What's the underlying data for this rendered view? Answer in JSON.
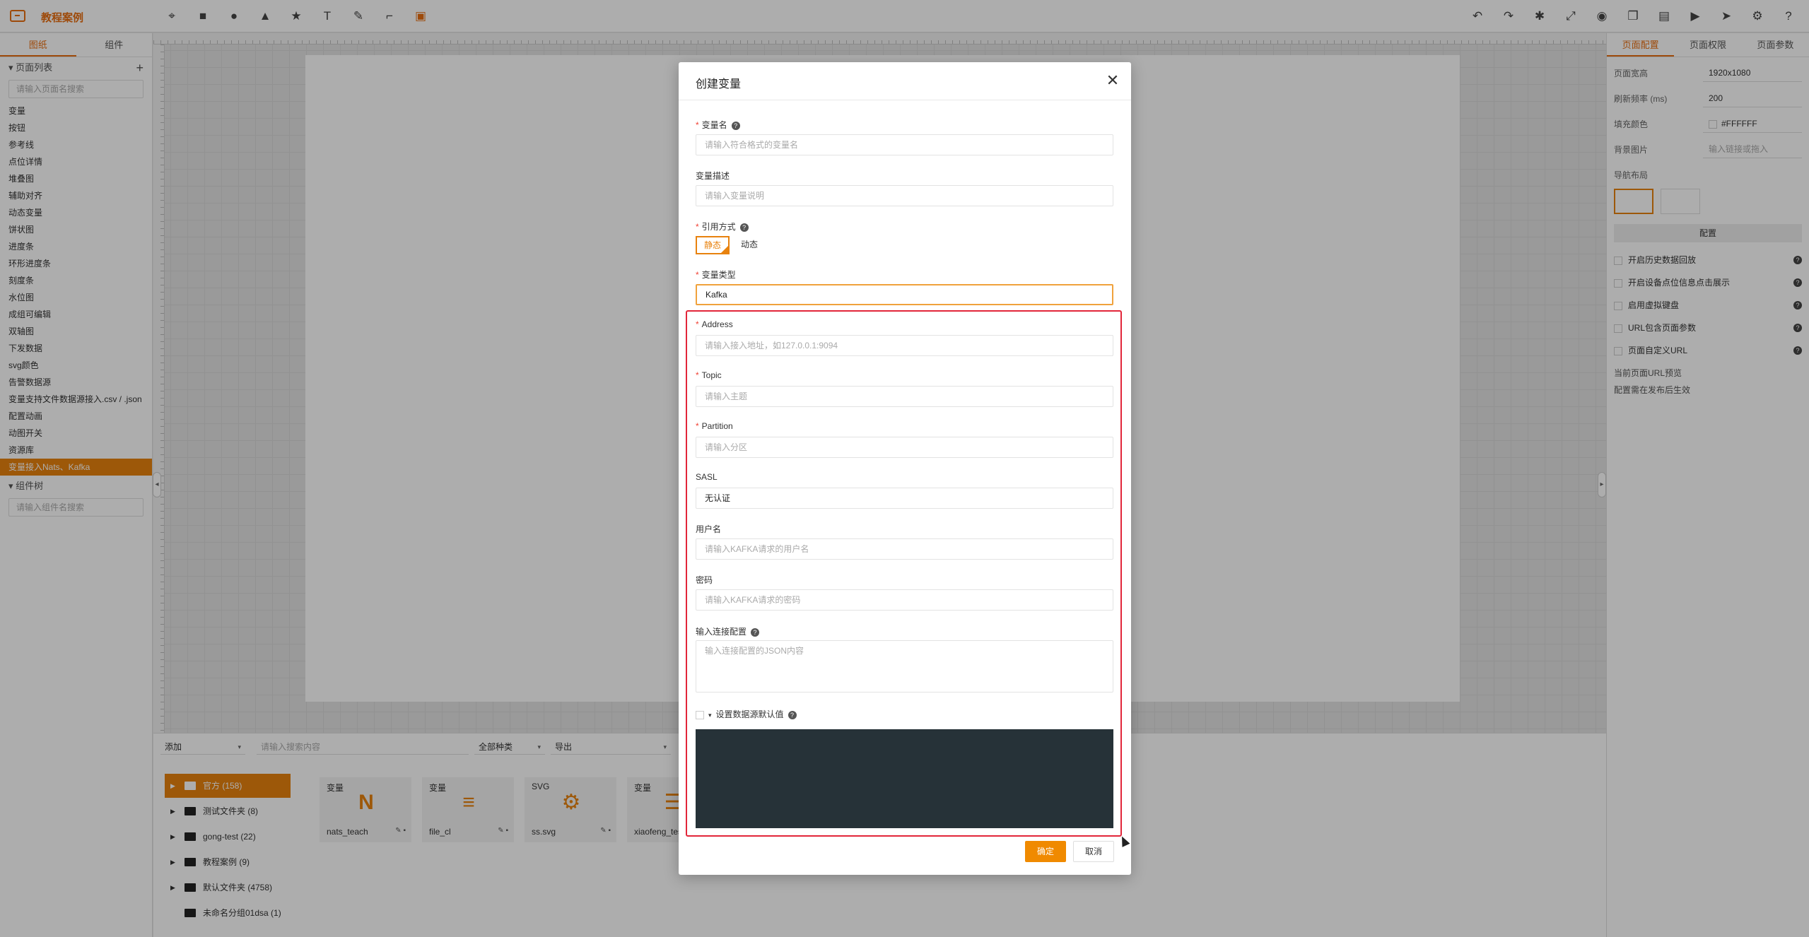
{
  "app": {
    "title": "教程案例"
  },
  "toolbar": {
    "left_tools": [
      "select-tool-icon",
      "rect-tool-icon",
      "circle-tool-icon",
      "triangle-tool-icon",
      "star-tool-icon",
      "text-tool-icon",
      "pen-tool-icon",
      "connector-tool-icon",
      "image-tool-icon"
    ],
    "right_tools": [
      "undo-icon",
      "redo-icon",
      "bug-icon",
      "fullscreen-icon",
      "palette-icon",
      "copy-icon",
      "save-icon",
      "play-icon",
      "send-icon",
      "settings-icon",
      "help-icon"
    ]
  },
  "left_panel": {
    "tabs": [
      "图纸",
      "组件"
    ],
    "page_list_title": "页面列表",
    "page_search_placeholder": "请输入页面名搜索",
    "pages": [
      "变量",
      "按钮",
      "参考线",
      "点位详情",
      "堆叠图",
      "辅助对齐",
      "动态变量",
      "饼状图",
      "进度条",
      "环形进度条",
      "刻度条",
      "水位图",
      "成组可编辑",
      "双轴图",
      "下发数据",
      "svg颜色",
      "告警数据源",
      "变量支持文件数据源接入.csv / .json",
      "配置动画",
      "动图开关",
      "资源库",
      "变量接入Nats、Kafka"
    ],
    "active_page_index": 21,
    "component_tree_title": "组件树",
    "component_search_placeholder": "请输入组件名搜索"
  },
  "bottom_panel": {
    "add_label": "添加",
    "search_placeholder": "请输入搜索内容",
    "type_filter": "全部种类",
    "export_label": "导出",
    "folders": [
      "官方 (158)",
      "测试文件夹 (8)",
      "gong-test (22)",
      "教程案例 (9)",
      "默认文件夹 (4758)",
      "未命名分组01dsa (1)"
    ],
    "assets": [
      {
        "tag": "变量",
        "name": "nats_teach",
        "thumb": "N"
      },
      {
        "tag": "变量",
        "name": "file_cl",
        "thumb": "≡"
      },
      {
        "tag": "SVG",
        "name": "ss.svg",
        "thumb": "⚙"
      },
      {
        "tag": "变量",
        "name": "xiaofeng_tes",
        "thumb": "☰"
      }
    ]
  },
  "right_panel": {
    "tabs": [
      "页面配置",
      "页面权限",
      "页面参数"
    ],
    "page_width_label": "页面宽高",
    "page_width_value": "1920x1080",
    "refresh_label": "刷新频率 (ms)",
    "refresh_value": "200",
    "fill_label": "填充颜色",
    "fill_value": "#FFFFFF",
    "bg_image_label": "背景图片",
    "bg_image_placeholder": "输入链接或拖入",
    "nav_layout_label": "导航布局",
    "config_button": "配置",
    "checks": [
      "开启历史数据回放",
      "开启设备点位信息点击展示",
      "启用虚拟键盘",
      "URL包含页面参数",
      "页面自定义URL"
    ],
    "url_preview_label": "当前页面URL预览",
    "publish_note": "配置需在发布后生效"
  },
  "modal": {
    "title": "创建变量",
    "fields": {
      "var_name": {
        "label": "变量名",
        "placeholder": "请输入符合格式的变量名"
      },
      "var_desc": {
        "label": "变量描述",
        "placeholder": "请输入变量说明"
      },
      "ref_mode": {
        "label": "引用方式",
        "options": [
          "静态",
          "动态"
        ],
        "selected": "静态"
      },
      "var_type": {
        "label": "变量类型",
        "value": "Kafka"
      },
      "address": {
        "label": "Address",
        "placeholder": "请输入接入地址，如127.0.0.1:9094"
      },
      "topic": {
        "label": "Topic",
        "placeholder": "请输入主题"
      },
      "partition": {
        "label": "Partition",
        "placeholder": "请输入分区"
      },
      "sasl": {
        "label": "SASL",
        "value": "无认证"
      },
      "username": {
        "label": "用户名",
        "placeholder": "请输入KAFKA请求的用户名"
      },
      "password": {
        "label": "密码",
        "placeholder": "请输入KAFKA请求的密码"
      },
      "conn_config": {
        "label": "输入连接配置",
        "placeholder": "输入连接配置的JSON内容"
      }
    },
    "default_value_toggle": "设置数据源默认值",
    "ok_button": "确定",
    "cancel_button": "取消"
  },
  "colors": {
    "accent": "#e8820e",
    "highlight": "#e2263a",
    "editor_bg": "#263238"
  }
}
